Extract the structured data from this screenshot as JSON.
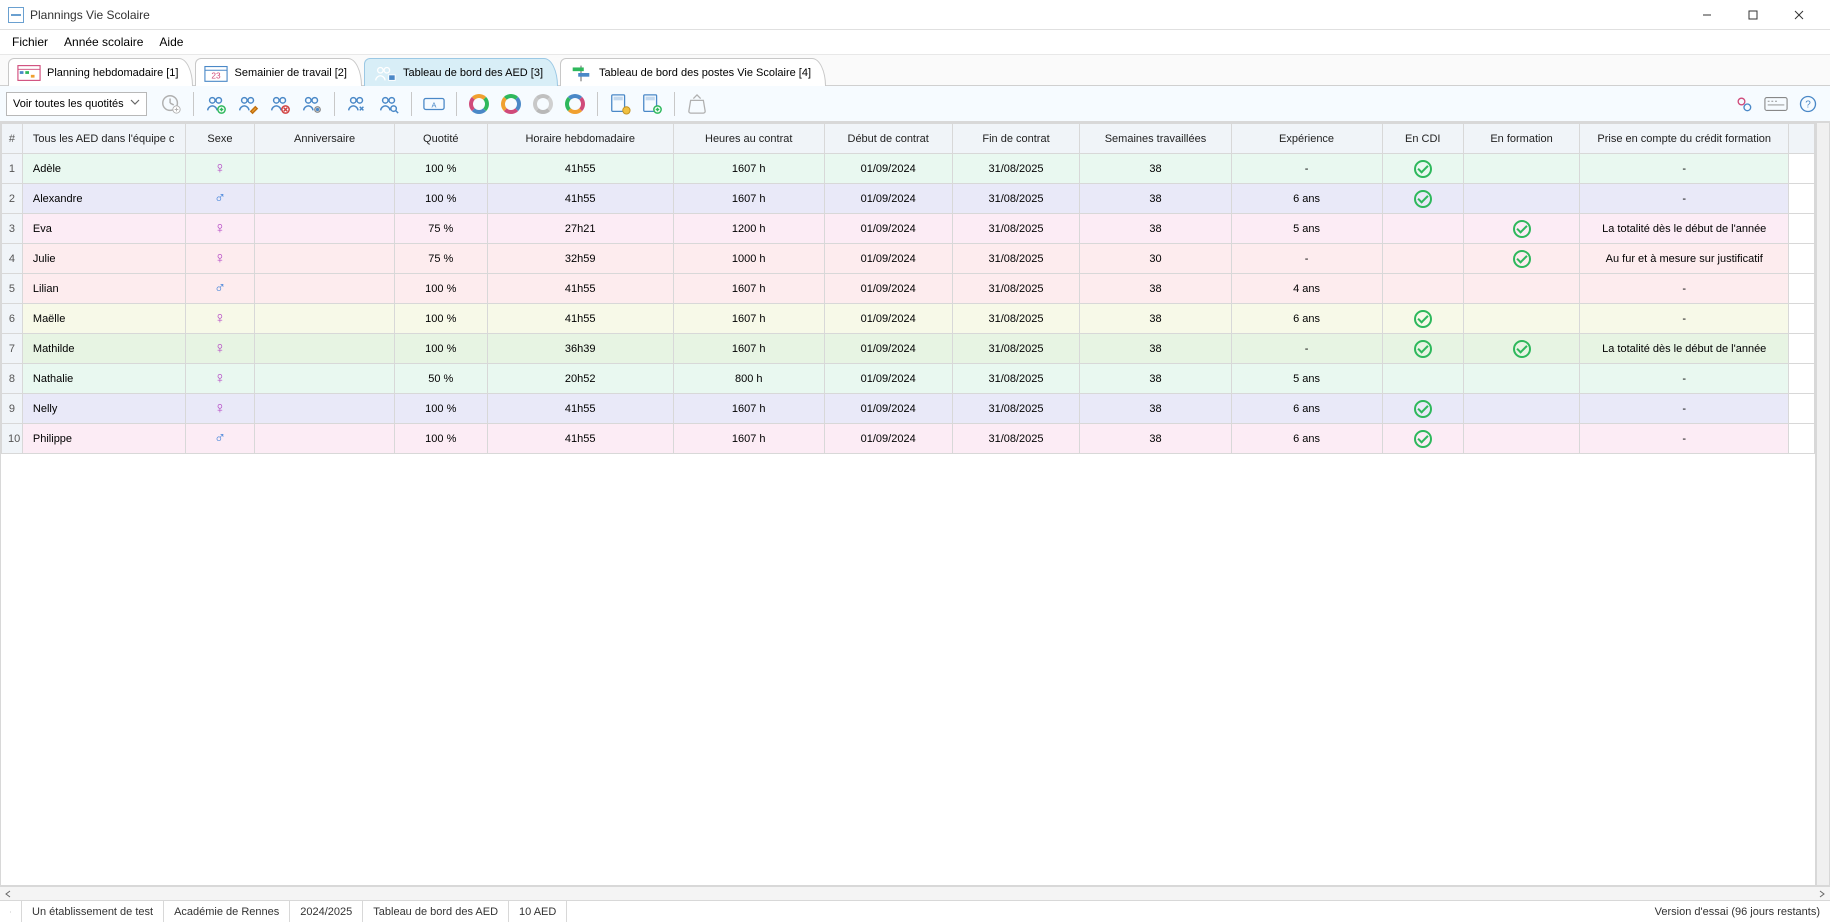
{
  "window": {
    "title": "Plannings Vie Scolaire"
  },
  "menu": {
    "file": "Fichier",
    "year": "Année scolaire",
    "help": "Aide"
  },
  "tabs": [
    {
      "label": "Planning hebdomadaire [1]",
      "icon": "planning"
    },
    {
      "label": "Semainier de travail [2]",
      "icon": "calendar"
    },
    {
      "label": "Tableau de bord des AED [3]",
      "icon": "people",
      "active": true
    },
    {
      "label": "Tableau de bord des postes Vie Scolaire [4]",
      "icon": "signpost"
    }
  ],
  "toolbar": {
    "filter_label": "Voir toutes les quotités"
  },
  "columns": {
    "num": "#",
    "name": "Tous les AED dans l'équipe c",
    "sex": "Sexe",
    "anniv": "Anniversaire",
    "quot": "Quotité",
    "hour": "Horaire hebdomadaire",
    "hcontract": "Heures au contrat",
    "debut": "Début de contrat",
    "fin": "Fin de contrat",
    "semaines": "Semaines travaillées",
    "exp": "Expérience",
    "cdi": "En CDI",
    "formation": "En formation",
    "credit": "Prise en compte du crédit formation"
  },
  "rows": [
    {
      "n": "1",
      "name": "Adèle",
      "sex": "F",
      "anniv": "",
      "quot": "100 %",
      "hour": "41h55",
      "hcontract": "1607 h",
      "debut": "01/09/2024",
      "fin": "31/08/2025",
      "sem": "38",
      "exp": "-",
      "cdi": true,
      "form": false,
      "credit": "-",
      "bg": "bg-mint"
    },
    {
      "n": "2",
      "name": "Alexandre",
      "sex": "M",
      "anniv": "",
      "quot": "100 %",
      "hour": "41h55",
      "hcontract": "1607 h",
      "debut": "01/09/2024",
      "fin": "31/08/2025",
      "sem": "38",
      "exp": "6 ans",
      "cdi": true,
      "form": false,
      "credit": "-",
      "bg": "bg-lav"
    },
    {
      "n": "3",
      "name": "Eva",
      "sex": "F",
      "anniv": "",
      "quot": "75 %",
      "hour": "27h21",
      "hcontract": "1200 h",
      "debut": "01/09/2024",
      "fin": "31/08/2025",
      "sem": "38",
      "exp": "5 ans",
      "cdi": false,
      "form": true,
      "credit": "La totalité dès le début de l'année",
      "bg": "bg-pink"
    },
    {
      "n": "4",
      "name": "Julie",
      "sex": "F",
      "anniv": "",
      "quot": "75 %",
      "hour": "32h59",
      "hcontract": "1000 h",
      "debut": "01/09/2024",
      "fin": "31/08/2025",
      "sem": "30",
      "exp": "-",
      "cdi": false,
      "form": true,
      "credit": "Au fur et à mesure sur justificatif",
      "bg": "bg-rose"
    },
    {
      "n": "5",
      "name": "Lilian",
      "sex": "M",
      "anniv": "",
      "quot": "100 %",
      "hour": "41h55",
      "hcontract": "1607 h",
      "debut": "01/09/2024",
      "fin": "31/08/2025",
      "sem": "38",
      "exp": "4 ans",
      "cdi": false,
      "form": false,
      "credit": "-",
      "bg": "bg-rose"
    },
    {
      "n": "6",
      "name": "Maëlle",
      "sex": "F",
      "anniv": "",
      "quot": "100 %",
      "hour": "41h55",
      "hcontract": "1607 h",
      "debut": "01/09/2024",
      "fin": "31/08/2025",
      "sem": "38",
      "exp": "6 ans",
      "cdi": true,
      "form": false,
      "credit": "-",
      "bg": "bg-yel"
    },
    {
      "n": "7",
      "name": "Mathilde",
      "sex": "F",
      "anniv": "",
      "quot": "100 %",
      "hour": "36h39",
      "hcontract": "1607 h",
      "debut": "01/09/2024",
      "fin": "31/08/2025",
      "sem": "38",
      "exp": "-",
      "cdi": true,
      "form": true,
      "credit": "La totalité dès le début de l'année",
      "bg": "bg-green"
    },
    {
      "n": "8",
      "name": "Nathalie",
      "sex": "F",
      "anniv": "",
      "quot": "50 %",
      "hour": "20h52",
      "hcontract": "800 h",
      "debut": "01/09/2024",
      "fin": "31/08/2025",
      "sem": "38",
      "exp": "5 ans",
      "cdi": false,
      "form": false,
      "credit": "-",
      "bg": "bg-mint"
    },
    {
      "n": "9",
      "name": "Nelly",
      "sex": "F",
      "anniv": "",
      "quot": "100 %",
      "hour": "41h55",
      "hcontract": "1607 h",
      "debut": "01/09/2024",
      "fin": "31/08/2025",
      "sem": "38",
      "exp": "6 ans",
      "cdi": true,
      "form": false,
      "credit": "-",
      "bg": "bg-lav"
    },
    {
      "n": "10",
      "name": "Philippe",
      "sex": "M",
      "anniv": "",
      "quot": "100 %",
      "hour": "41h55",
      "hcontract": "1607 h",
      "debut": "01/09/2024",
      "fin": "31/08/2025",
      "sem": "38",
      "exp": "6 ans",
      "cdi": true,
      "form": false,
      "credit": "-",
      "bg": "bg-pink"
    }
  ],
  "status": {
    "school": "Un établissement de test",
    "academy": "Académie de Rennes",
    "year": "2024/2025",
    "view": "Tableau de bord des AED",
    "count": "10 AED",
    "version": "Version d'essai (96 jours restants)"
  }
}
